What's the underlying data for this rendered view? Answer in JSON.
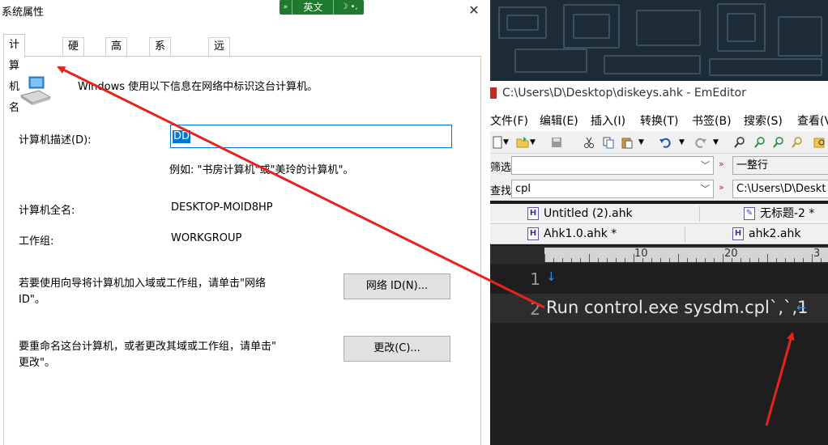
{
  "dialog": {
    "title": "系统属性",
    "close_glyph": "✕",
    "tabs": [
      "计算机名",
      "硬件",
      "高级",
      "系统保护",
      "远程"
    ],
    "intro": "Windows 使用以下信息在网络中标识这台计算机。",
    "description_label": "计算机描述(D):",
    "description_value": "DD",
    "example": "例如: \"书房计算机\"或\"美玲的计算机\"。",
    "full_name_label": "计算机全名:",
    "full_name_value": "DESKTOP-MOID8HP",
    "workgroup_label": "工作组:",
    "workgroup_value": "WORKGROUP",
    "join_text_1": "若要使用向导将计算机加入域或工作组，请单击\"网络",
    "join_text_2": "ID\"。",
    "network_id_button": "网络 ID(N)...",
    "rename_text_1": "要重命名这台计算机，或者更改其域或工作组，请单击\"",
    "rename_text_2": "更改\"。",
    "change_button": "更改(C)..."
  },
  "ime_bar": {
    "left": "»",
    "language": "英文",
    "right": "☽ •,"
  },
  "editor": {
    "title": "C:\\Users\\D\\Desktop\\diskeys.ahk - EmEditor",
    "menu": [
      "文件(F)",
      "编辑(E)",
      "插入(I)",
      "转换(T)",
      "书签(B)",
      "搜索(S)",
      "查看(V"
    ],
    "filter_label": "筛选",
    "filter_value": "",
    "filter_mode": "一整行",
    "find_label": "查找",
    "find_value": "cpl",
    "find_path": "C:\\Users\\D\\Deskt",
    "tabs_row1": [
      "Untitled (2).ahk",
      "无标题-2 *"
    ],
    "tabs_row2": [
      "Ahk1.0.ahk *",
      "ahk2.ahk"
    ],
    "ruler_marks": [
      "10",
      "20",
      "3"
    ],
    "lines": [
      {
        "number": "1",
        "text": ""
      },
      {
        "number": "2",
        "text": "Run control.exe sysdm.cpl`,`,1"
      }
    ]
  },
  "colors": {
    "annotation_arrow": "#e8231e",
    "selection": "#0078d7",
    "ime_green": "#1f7a2e",
    "editor_bg": "#1e1e1e"
  }
}
